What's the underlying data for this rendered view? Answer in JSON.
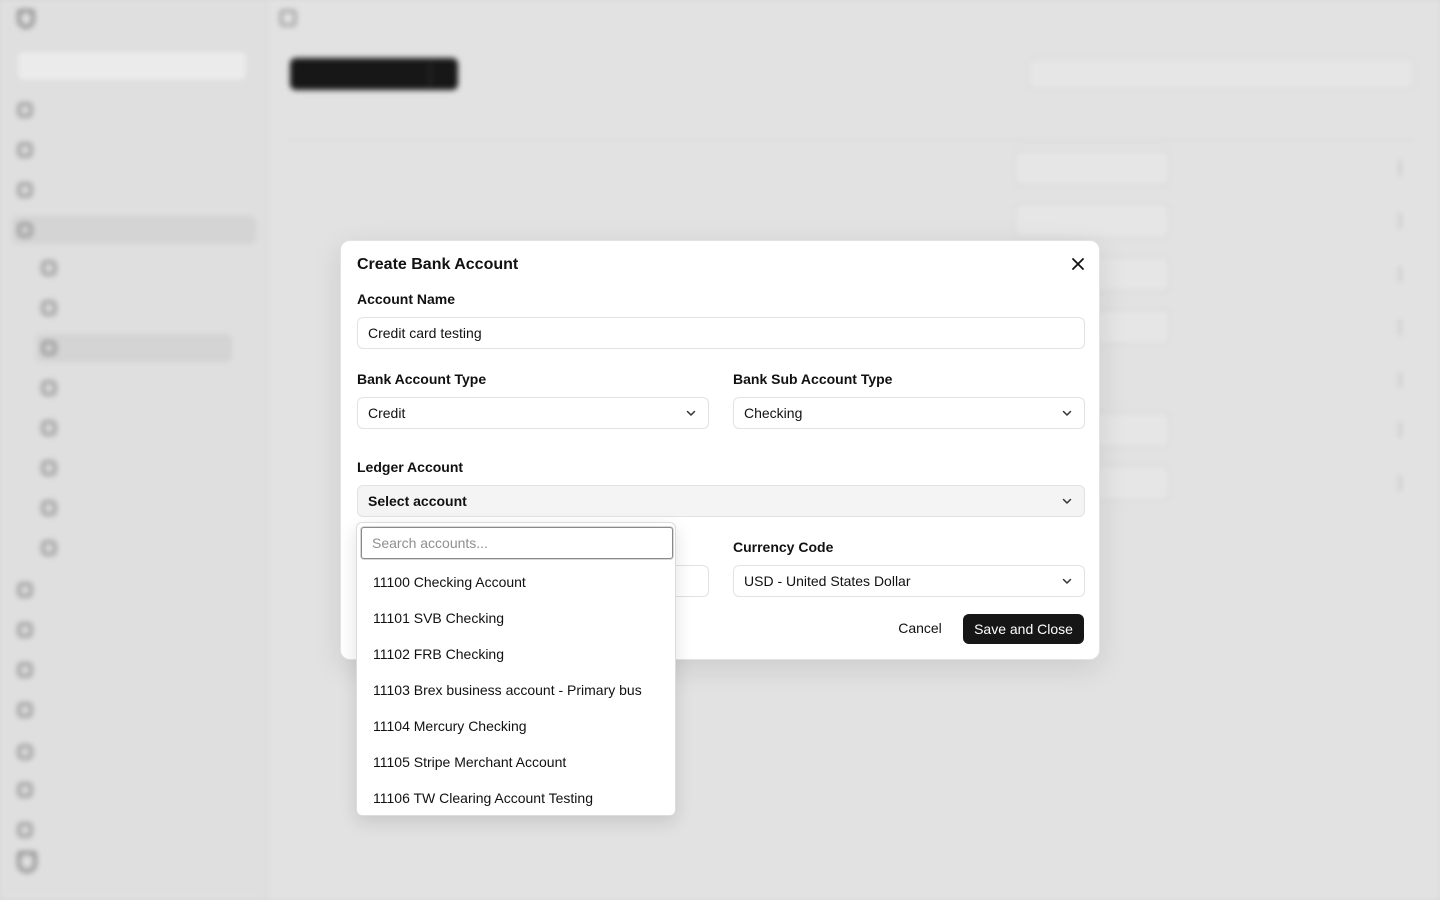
{
  "modal": {
    "title": "Create Bank Account",
    "account_name_label": "Account Name",
    "account_name_value": "Credit card testing",
    "bank_account_type_label": "Bank Account Type",
    "bank_account_type_value": "Credit",
    "bank_sub_account_type_label": "Bank Sub Account Type",
    "bank_sub_account_type_value": "Checking",
    "ledger_account_label": "Ledger Account",
    "ledger_account_value": "Select account",
    "currency_code_label": "Currency Code",
    "currency_code_value": "USD - United States Dollar",
    "cancel_label": "Cancel",
    "save_label": "Save and Close"
  },
  "ledger_dropdown": {
    "search_placeholder": "Search accounts...",
    "items": [
      "11100 Checking Account",
      "11101 SVB Checking",
      "11102 FRB Checking",
      "11103 Brex business account - Primary bus",
      "11104 Mercury Checking",
      "11105 Stripe Merchant Account",
      "11106 TW Clearing Account Testing"
    ]
  },
  "colors": {
    "primary_button": "#161616",
    "modal_bg": "#ffffff",
    "backdrop": "#ebebeb"
  }
}
